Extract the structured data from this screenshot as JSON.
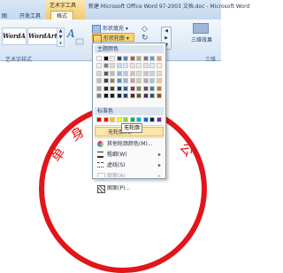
{
  "titlebar": {
    "context_group": "艺术字工具",
    "title": "新建 Microsoft Office Word 97-2003 文档.doc - Microsoft Word"
  },
  "tabs": [
    "图",
    "开发工具",
    "格式"
  ],
  "ribbon": {
    "wordart_samples": [
      "WordArt",
      "WordArt"
    ],
    "group_label": "艺术字样式",
    "shape_fill": "形状填充",
    "shape_outline": "形状轮廓",
    "threed": "三维效果",
    "threed_group": "三维"
  },
  "menu": {
    "theme_colors_label": "主题颜色",
    "standard_colors_label": "标准色",
    "no_outline": "无轮廓(N)",
    "more_colors": "其他轮廓颜色(M)...",
    "weight": "粗细(W)",
    "dashes": "虚线(S)",
    "pattern": "图案(A)",
    "pattern_lines": "图案(P)...",
    "tooltip": "无轮廓",
    "theme_colors": [
      [
        "#ffffff",
        "#000000",
        "#eeece1",
        "#1f497d",
        "#4f81bd",
        "#c0504d",
        "#9bbb59",
        "#8064a2",
        "#4bacc6",
        "#f79646"
      ],
      [
        "#f2f2f2",
        "#7f7f7f",
        "#ddd9c3",
        "#c6d9f0",
        "#dbe5f1",
        "#f2dcdb",
        "#ebf1dd",
        "#e5e0ec",
        "#dbeef3",
        "#fdeada"
      ],
      [
        "#d8d8d8",
        "#595959",
        "#c4bd97",
        "#8db3e2",
        "#b8cce4",
        "#e5b9b7",
        "#d7e3bc",
        "#ccc1d9",
        "#b7dde8",
        "#fbd5b5"
      ],
      [
        "#bfbfbf",
        "#3f3f3f",
        "#938953",
        "#548dd4",
        "#95b3d7",
        "#d99694",
        "#c3d69b",
        "#b2a2c7",
        "#92cddc",
        "#fac08f"
      ],
      [
        "#a5a5a5",
        "#262626",
        "#494429",
        "#17365d",
        "#366092",
        "#953734",
        "#76923c",
        "#5f497a",
        "#31859b",
        "#e36c09"
      ],
      [
        "#7f7f7f",
        "#0c0c0c",
        "#1d1b10",
        "#0f243e",
        "#244061",
        "#632423",
        "#4f6128",
        "#3f3151",
        "#205867",
        "#974806"
      ]
    ],
    "standard_colors": [
      "#c00000",
      "#ff0000",
      "#ffc000",
      "#ffff00",
      "#92d050",
      "#00b050",
      "#00b0f0",
      "#0070c0",
      "#002060",
      "#7030a0"
    ]
  },
  "document": {
    "seal_text": [
      "单",
      "身",
      "公"
    ]
  }
}
